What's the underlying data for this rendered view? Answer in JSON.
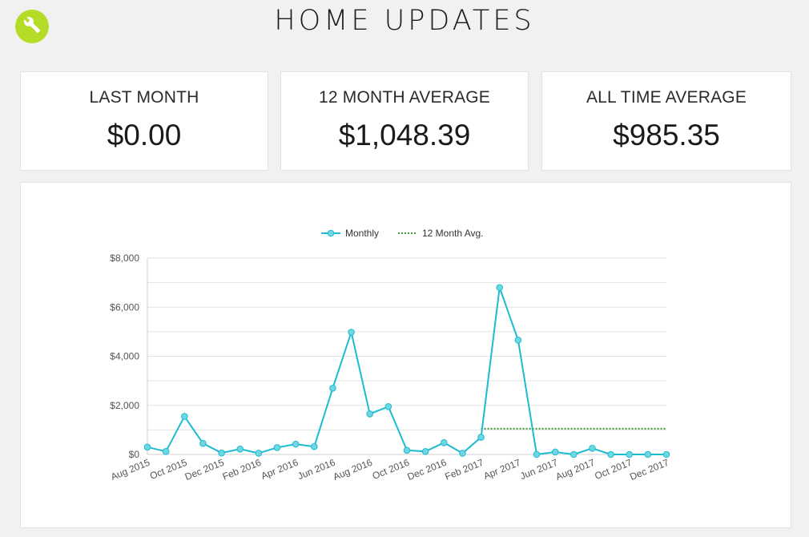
{
  "header": {
    "title": "HOME UPDATES",
    "settings_icon": "wrench-icon",
    "accent_color": "#b5dc26"
  },
  "summary": [
    {
      "label": "LAST MONTH",
      "value": "$0.00"
    },
    {
      "label": "12 MONTH AVERAGE",
      "value": "$1,048.39"
    },
    {
      "label": "ALL TIME AVERAGE",
      "value": "$985.35"
    }
  ],
  "chart_data": {
    "type": "line",
    "legend_placement": "top-center",
    "grid": true,
    "ylim": [
      0,
      8000
    ],
    "y_ticks": [
      0,
      2000,
      4000,
      6000,
      8000
    ],
    "y_tick_labels": [
      "$0",
      "$2,000",
      "$4,000",
      "$6,000",
      "$8,000"
    ],
    "x": [
      "Aug 2015",
      "Sep 2015",
      "Oct 2015",
      "Nov 2015",
      "Dec 2015",
      "Jan 2016",
      "Feb 2016",
      "Mar 2016",
      "Apr 2016",
      "May 2016",
      "Jun 2016",
      "Jul 2016",
      "Aug 2016",
      "Sep 2016",
      "Oct 2016",
      "Nov 2016",
      "Dec 2016",
      "Jan 2017",
      "Feb 2017",
      "Mar 2017",
      "Apr 2017",
      "May 2017",
      "Jun 2017",
      "Jul 2017",
      "Aug 2017",
      "Sep 2017",
      "Oct 2017",
      "Nov 2017",
      "Dec 2017"
    ],
    "x_tick_labels": [
      "Aug 2015",
      "Oct 2015",
      "Dec 2015",
      "Feb 2016",
      "Apr 2016",
      "Jun 2016",
      "Aug 2016",
      "Oct 2016",
      "Dec 2016",
      "Feb 2017",
      "Apr 2017",
      "Jun 2017",
      "Aug 2017",
      "Oct 2017",
      "Dec 2017"
    ],
    "series": [
      {
        "name": "Monthly",
        "color": "#1bbcd0",
        "style": "solid-with-markers",
        "values": [
          300,
          120,
          1550,
          450,
          60,
          220,
          50,
          280,
          420,
          320,
          2700,
          4980,
          1650,
          1950,
          170,
          120,
          480,
          50,
          700,
          6800,
          4660,
          0,
          100,
          0,
          250,
          0,
          0,
          0,
          0
        ]
      },
      {
        "name": "12 Month Avg.",
        "color": "#3a9a2e",
        "style": "dotted",
        "x_range": [
          "Feb 2017",
          "Dec 2017"
        ],
        "value": 1048.39
      }
    ]
  }
}
